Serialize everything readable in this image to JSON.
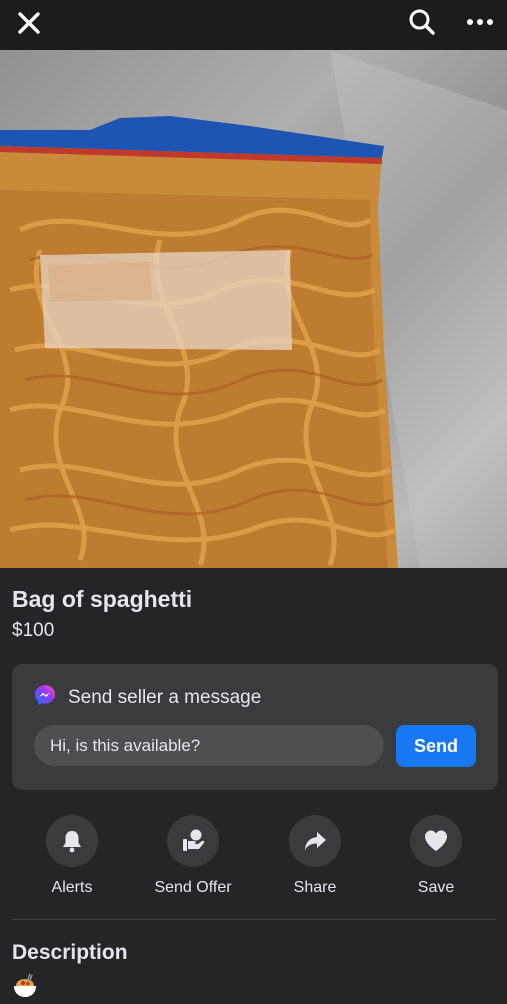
{
  "listing": {
    "title": "Bag of spaghetti",
    "price": "$100"
  },
  "message": {
    "heading": "Send seller a message",
    "input_value": "Hi, is this available?",
    "send_label": "Send"
  },
  "actions": [
    {
      "label": "Alerts",
      "icon": "bell-icon"
    },
    {
      "label": "Send Offer",
      "icon": "offer-icon"
    },
    {
      "label": "Share",
      "icon": "share-icon"
    },
    {
      "label": "Save",
      "icon": "heart-icon"
    }
  ],
  "description": {
    "heading": "Description",
    "emoji": "spaghetti-emoji"
  },
  "colors": {
    "background": "#242526",
    "card": "#3a3b3c",
    "accent": "#1877f2"
  }
}
